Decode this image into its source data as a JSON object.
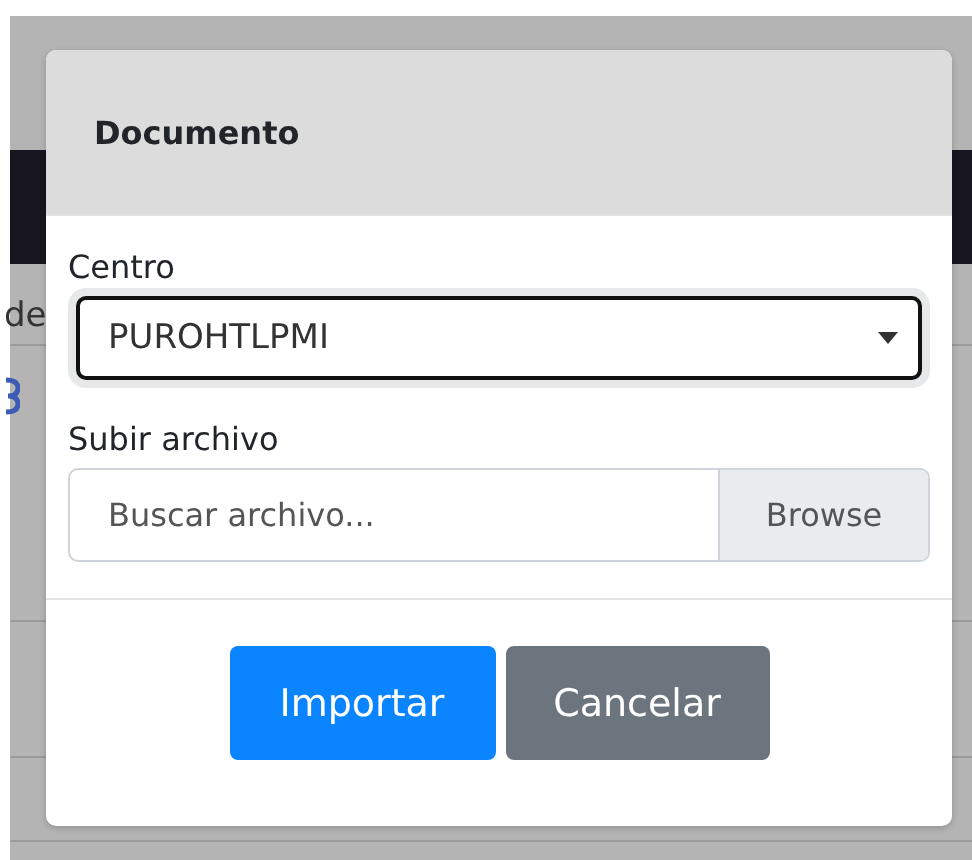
{
  "background": {
    "partial_text": "de"
  },
  "modal": {
    "title": "Documento",
    "centro": {
      "label": "Centro",
      "value": "PUROHTLPMI"
    },
    "upload": {
      "label": "Subir archivo",
      "placeholder": "Buscar archivo...",
      "browse": "Browse"
    },
    "buttons": [
      {
        "label": "Importar",
        "kind": "primary"
      },
      {
        "label": "Cancelar",
        "kind": "secondary"
      }
    ]
  }
}
